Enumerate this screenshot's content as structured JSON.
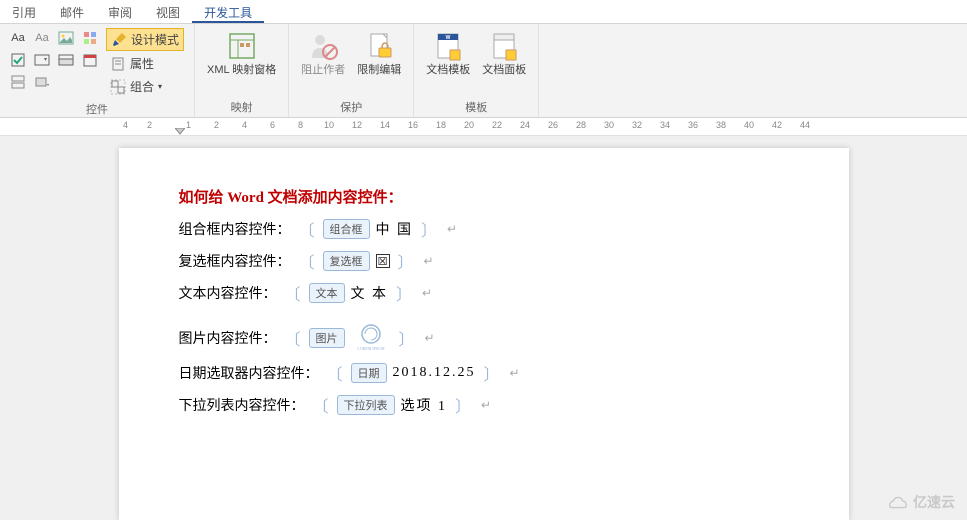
{
  "tabs": [
    "引用",
    "邮件",
    "审阅",
    "视图",
    "开发工具"
  ],
  "active_tab": 4,
  "ribbon": {
    "groups": {
      "controls": {
        "label": "控件",
        "design_mode": "设计模式",
        "properties": "属性",
        "group": "组合"
      },
      "mapping": {
        "label": "映射",
        "xml_pane": "XML 映射窗格"
      },
      "protect": {
        "label": "保护",
        "block_authors": "阻止作者",
        "restrict_edit": "限制编辑"
      },
      "templates": {
        "label": "模板",
        "doc_template": "文档模板",
        "doc_panel": "文档面板"
      }
    }
  },
  "ruler": {
    "numbers": [
      "4",
      "2",
      "1",
      "2",
      "4",
      "6",
      "8",
      "10",
      "12",
      "14",
      "16",
      "18",
      "20",
      "22",
      "24",
      "26",
      "28",
      "30",
      "32",
      "34",
      "36",
      "38",
      "40",
      "42",
      "44"
    ]
  },
  "document": {
    "title": "如何给 Word 文档添加内容控件：",
    "lines": [
      {
        "label": "组合框内容控件：",
        "tag": "组合框",
        "value": "中  国"
      },
      {
        "label": "复选框内容控件：",
        "tag": "复选框",
        "checkbox": true
      },
      {
        "label": "文本内容控件：",
        "tag": "文本",
        "value": "文  本"
      }
    ],
    "lines2": [
      {
        "label": "图片内容控件：",
        "tag": "图片",
        "image": true
      },
      {
        "label": "日期选取器内容控件：",
        "tag": "日期",
        "value": "2018.12.25"
      },
      {
        "label": "下拉列表内容控件：",
        "tag": "下拉列表",
        "value": "选项 1"
      }
    ]
  },
  "watermark": "亿速云"
}
